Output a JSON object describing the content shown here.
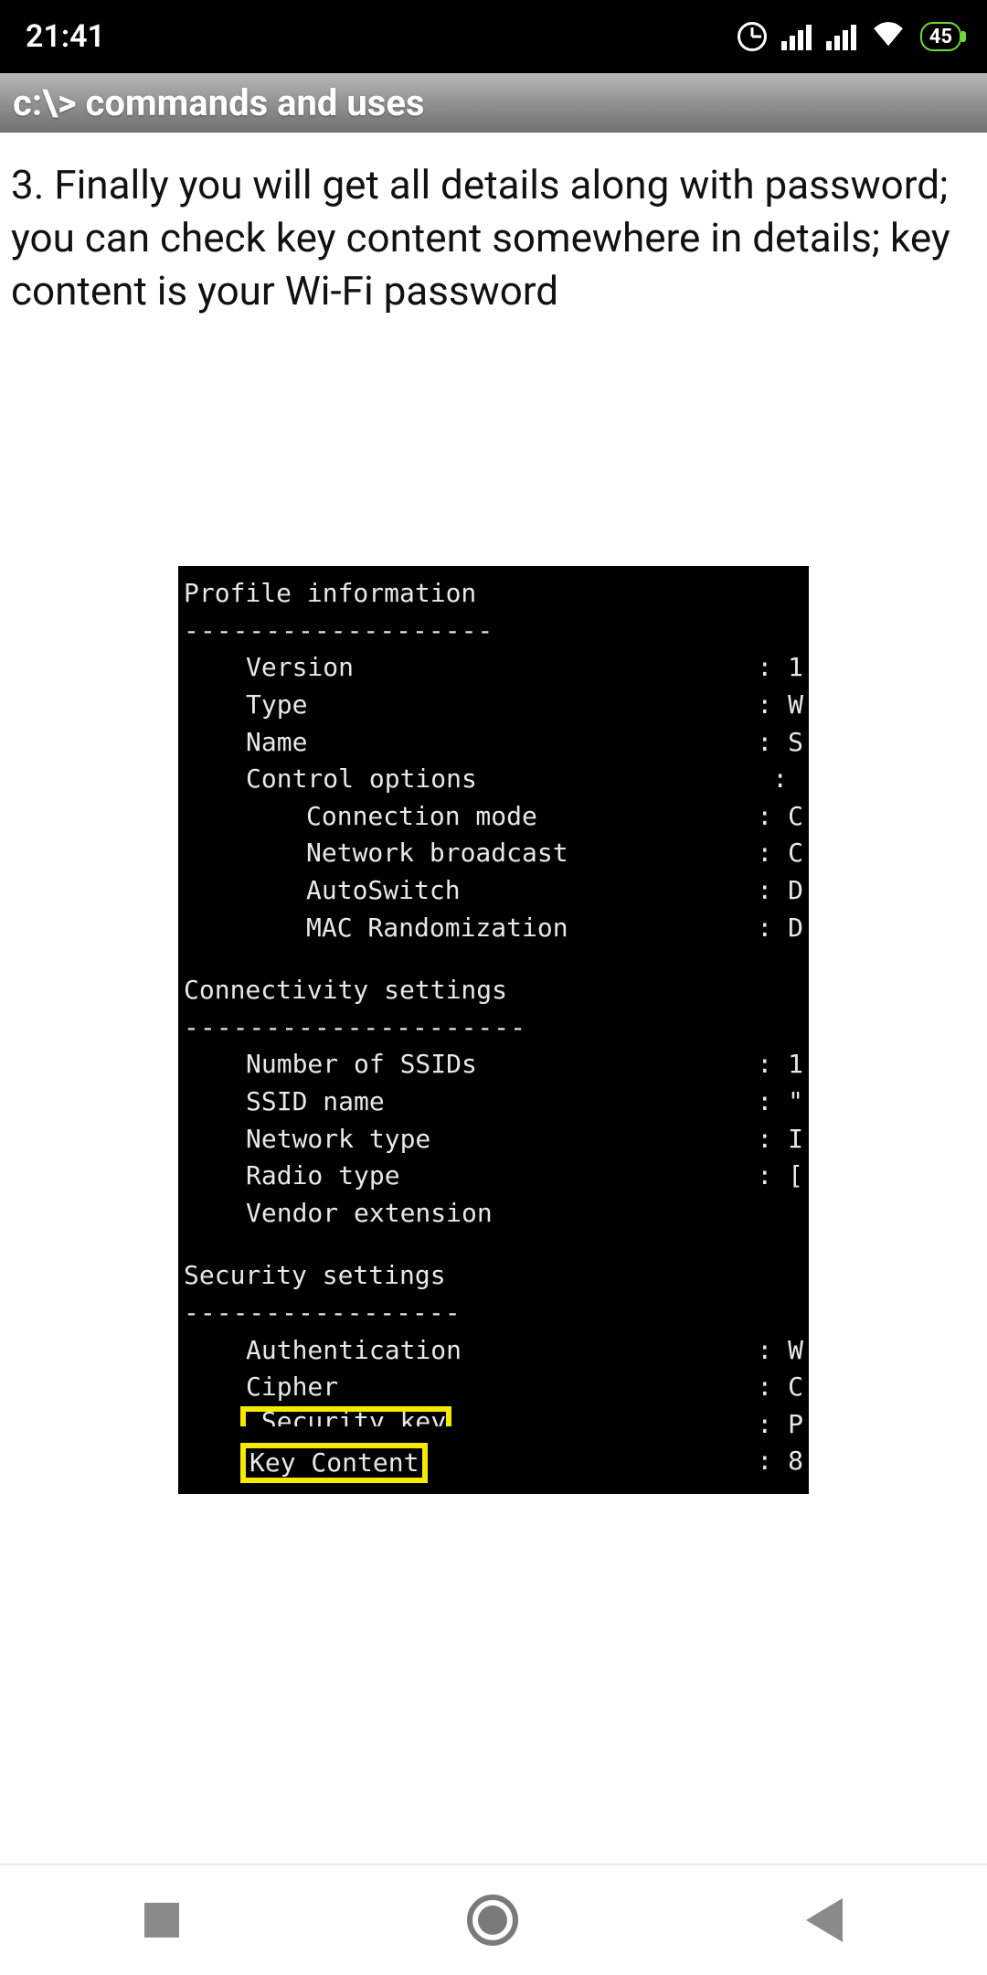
{
  "status": {
    "time": "21:41",
    "battery": "45"
  },
  "title_bar": "c:\\> commands and uses",
  "article_text": "3.  Finally you will get all details along with password; you can check key content somewhere in details; key content is your Wi-Fi password",
  "terminal": {
    "sections": [
      {
        "heading": "Profile information",
        "dashes": "-------------------",
        "rows": [
          {
            "label": "Version",
            "indent": 1,
            "val": "1"
          },
          {
            "label": "Type",
            "indent": 1,
            "val": "W"
          },
          {
            "label": "Name",
            "indent": 1,
            "val": "S"
          },
          {
            "label": "Control options",
            "indent": 1,
            "val": ""
          },
          {
            "label": "Connection mode",
            "indent": 2,
            "val": "C"
          },
          {
            "label": "Network broadcast",
            "indent": 2,
            "val": "C"
          },
          {
            "label": "AutoSwitch",
            "indent": 2,
            "val": "D"
          },
          {
            "label": "MAC Randomization",
            "indent": 2,
            "val": "D"
          }
        ]
      },
      {
        "heading": "Connectivity settings",
        "dashes": "---------------------",
        "rows": [
          {
            "label": "Number of SSIDs",
            "indent": 1,
            "val": "1"
          },
          {
            "label": "SSID name",
            "indent": 1,
            "val": "\""
          },
          {
            "label": "Network type",
            "indent": 1,
            "val": "I"
          },
          {
            "label": "Radio type",
            "indent": 1,
            "val": "["
          },
          {
            "label": "Vendor extension",
            "indent": 1,
            "val": ""
          }
        ]
      },
      {
        "heading": "Security settings",
        "dashes": "-----------------",
        "rows": [
          {
            "label": "Authentication",
            "indent": 1,
            "val": "W"
          },
          {
            "label": "Cipher",
            "indent": 1,
            "val": "C"
          },
          {
            "label": "Security key",
            "indent": 1,
            "val": "P",
            "partial_highlight": true
          },
          {
            "label": "Key Content",
            "indent": 1,
            "val": "8",
            "highlight": true
          }
        ]
      }
    ]
  },
  "colors": {
    "highlight": "#f5eb00",
    "battery": "#6bdc3a"
  }
}
